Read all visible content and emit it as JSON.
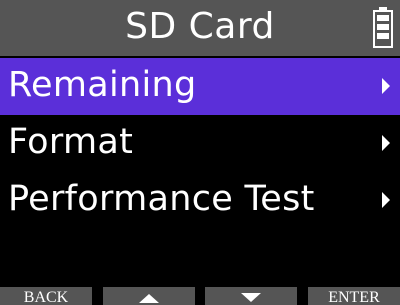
{
  "header": {
    "title": "SD Card",
    "battery_icon": "battery-icon"
  },
  "menu": {
    "items": [
      {
        "label": "Remaining",
        "selected": true,
        "icon": "chevron-right-icon"
      },
      {
        "label": "Format",
        "selected": false,
        "icon": "chevron-right-icon"
      },
      {
        "label": "Performance Test",
        "selected": false,
        "icon": "chevron-right-icon"
      }
    ]
  },
  "softkeys": {
    "back_label": "BACK",
    "up_icon": "arrow-up-icon",
    "down_icon": "arrow-down-icon",
    "enter_label": "ENTER"
  },
  "colors": {
    "selection": "#5b2fd9",
    "bar": "#555555",
    "background": "#000000"
  }
}
